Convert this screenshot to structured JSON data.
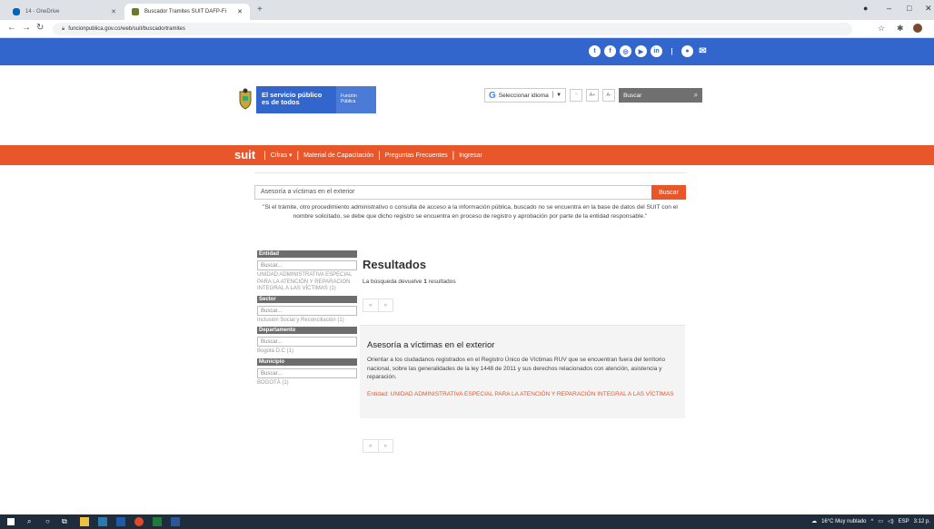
{
  "browser": {
    "tabs": [
      {
        "title": "14 - OneDrive",
        "favicon_color": "#0364b8"
      },
      {
        "title": "Buscador Tramites SUIT DAFP-Fi",
        "favicon_color": "#6b7a2a"
      }
    ],
    "url": "funcionpublica.gov.co/web/suit/buscadortramites"
  },
  "header": {
    "logo_line1": "El servicio público",
    "logo_line2": "es de todos",
    "brand_line1": "Función",
    "brand_line2": "Pública",
    "language_label": "Seleccionar idioma",
    "font_plus": "A+",
    "font_minus": "A-",
    "search_placeholder": "Buscar"
  },
  "menu": {
    "brand": "suit",
    "items": [
      "Cifras",
      "Material de Capacitación",
      "Preguntas Frecuentes",
      "Ingresar"
    ]
  },
  "search": {
    "query": "Asesoría a víctimas en el exterior",
    "button": "Buscar",
    "notice": "\"Si el trámite, otro procedimiento administrativo o consulta de acceso a la información pública, buscado no se encuentra en la base de datos del SUIT con el nombre solicitado, se debe que dicho registro se encuentra en proceso de registro y aprobación por parte de la entidad responsable.\""
  },
  "filters": [
    {
      "title": "Entidad",
      "placeholder": "Buscar...",
      "items": [
        "UNIDAD ADMINISTRATIVA ESPECIAL PARA LA ATENCIÓN Y REPARACIÓN INTEGRAL A LAS VÍCTIMAS (1)"
      ]
    },
    {
      "title": "Sector",
      "placeholder": "Buscar...",
      "items": [
        "Inclusión Social y Reconciliación (1)"
      ]
    },
    {
      "title": "Departamento",
      "placeholder": "Buscar...",
      "items": [
        "Bogotá D.C (1)"
      ]
    },
    {
      "title": "Municipio",
      "placeholder": "Buscar...",
      "items": [
        "BOGOTÁ (1)"
      ]
    }
  ],
  "results": {
    "title": "Resultados",
    "count_prefix": "La búsqueda devuelve ",
    "count": "1",
    "count_suffix": " resultados",
    "pager_prev": "«",
    "pager_next": "»",
    "items": [
      {
        "title": "Asesoría a víctimas en el exterior",
        "description": "Orientar a los ciudadanos registrados en el Registro Único de Víctimas RUV que se encuentran fuera del territorio nacional, sobre las generalidades de la ley 1448 de 2011 y sus derechos relacionados con atención, asistencia y reparación.",
        "entity": "Entidad: UNIDAD ADMINISTRATIVA ESPECIAL PARA LA ATENCIÓN Y REPARACIÓN INTEGRAL A LAS VÍCTIMAS"
      }
    ]
  },
  "taskbar": {
    "weather": "16°C  Muy nublado",
    "lang": "ESP",
    "time": "3:12 p."
  },
  "colors": {
    "gov_blue": "#3366cc",
    "suit_orange": "#e9562a",
    "filter_header": "#6d6d6d"
  }
}
